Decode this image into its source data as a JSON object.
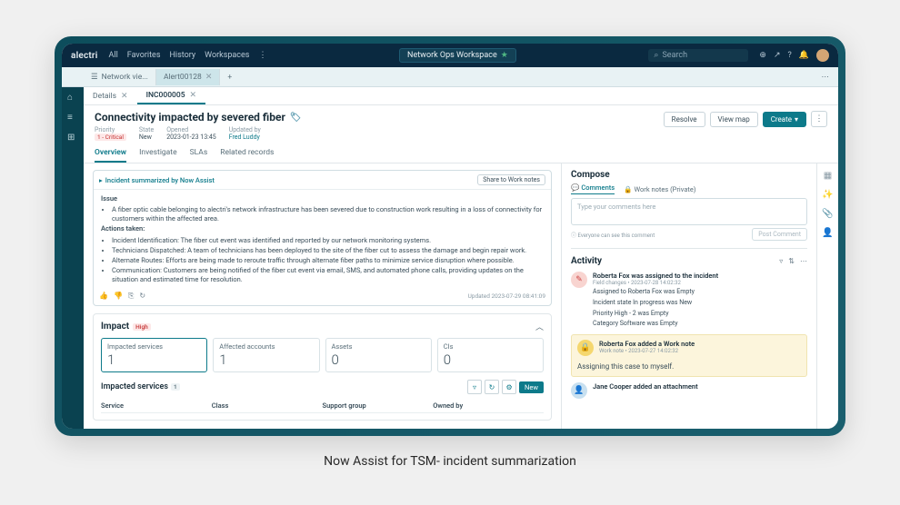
{
  "caption": "Now Assist for TSM- incident summarization",
  "topbar": {
    "brand": "alectri",
    "nav": [
      "All",
      "Favorites",
      "History",
      "Workspaces"
    ],
    "workspace": "Network Ops Workspace",
    "search_placeholder": "Search"
  },
  "subtabs": [
    {
      "icon": "☰",
      "label": "Network vie...",
      "active": false
    },
    {
      "icon": "",
      "label": "Alert00128",
      "active": true
    }
  ],
  "file_tabs": [
    {
      "label": "Details",
      "active": false
    },
    {
      "label": "INC000005",
      "active": true
    }
  ],
  "record": {
    "title": "Connectivity impacted by severed fiber",
    "meta": {
      "priority_label": "Priority",
      "priority_val": "1 - Critical",
      "state_label": "State",
      "state_val": "New",
      "opened_label": "Opened",
      "opened_val": "2023-01-23 13:45",
      "updatedby_label": "Updated by",
      "updatedby_val": "Fred Luddy"
    },
    "actions": {
      "resolve": "Resolve",
      "viewmap": "View map",
      "create": "Create"
    }
  },
  "view_tabs": [
    "Overview",
    "Investigate",
    "SLAs",
    "Related records"
  ],
  "assist": {
    "title": "Incident summarized by Now Assist",
    "share": "Share to Work notes",
    "issue_label": "Issue",
    "issue_text": "A fiber optic cable belonging to alectri's network infrastructure has been severed due to construction work resulting in a loss of connectivity for customers within the affected area.",
    "actions_label": "Actions taken:",
    "actions": [
      "Incident Identification: The fiber cut event was identified and reported by our network monitoring systems.",
      "Technicians Dispatched: A team of technicians has been deployed to the site of the fiber cut to assess the damage and begin repair work.",
      "Alternate Routes: Efforts are being made to reroute traffic through alternate fiber paths to minimize service disruption where possible.",
      "Communication: Customers are being notified of the fiber cut event via email, SMS, and automated phone calls, providing updates on the situation and estimated time for resolution."
    ],
    "updated": "Updated 2023-07-29 08:41:09"
  },
  "impact": {
    "title": "Impact",
    "badge": "High",
    "stats": [
      {
        "label": "Impacted services",
        "value": "1",
        "selected": true
      },
      {
        "label": "Affected accounts",
        "value": "1",
        "selected": false
      },
      {
        "label": "Assets",
        "value": "0",
        "selected": false
      },
      {
        "label": "CIs",
        "value": "0",
        "selected": false
      }
    ],
    "services_title": "Impacted services",
    "services_count": "1",
    "new_btn": "New",
    "columns": [
      "Service",
      "Class",
      "Support group",
      "Owned by"
    ]
  },
  "compose": {
    "title": "Compose",
    "tab_comments": "Comments",
    "tab_worknotes": "Work notes (Private)",
    "placeholder": "Type your comments here",
    "visibility": "Everyone can see this comment",
    "post": "Post Comment"
  },
  "activity": {
    "title": "Activity",
    "items": [
      {
        "avatar": "pink",
        "icon": "✎",
        "head": "Roberta Fox was assigned to the incident",
        "sub": "Field changes • 2023-07-28 14:02:32",
        "changes": [
          "Assigned to  Roberta Fox was Empty",
          "Incident state  In progress was New",
          "Priority  High - 2 was Empty",
          "Category  Software was Empty"
        ]
      },
      {
        "avatar": "yellow",
        "icon": "🔒",
        "type": "note",
        "head": "Roberta Fox added a Work note",
        "sub": "Work note • 2023-07-27 14:02:32",
        "note": "Assigning this case to myself."
      },
      {
        "avatar": "blue",
        "icon": "👤",
        "head": "Jane Cooper added an attachment",
        "sub": ""
      }
    ]
  }
}
